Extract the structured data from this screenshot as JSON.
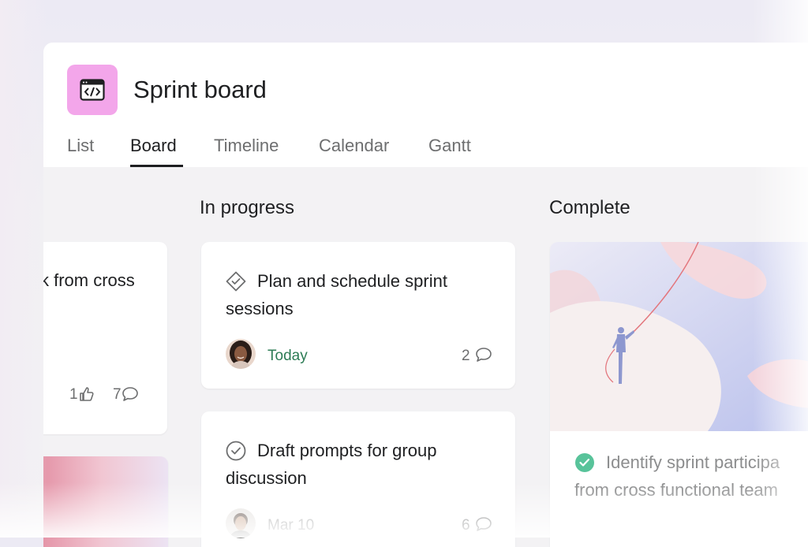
{
  "header": {
    "project_icon": "code-window-icon",
    "title": "Sprint board",
    "tabs": [
      {
        "label": "List"
      },
      {
        "label": "Board"
      },
      {
        "label": "Timeline"
      },
      {
        "label": "Calendar"
      },
      {
        "label": "Gantt"
      }
    ],
    "active_tab": "Board"
  },
  "columns": {
    "partial": {
      "card_text": "k from cross",
      "likes": "1",
      "comments": "7"
    },
    "in_progress": {
      "title": "In progress",
      "cards": [
        {
          "title_line1": "Plan and schedule sprint",
          "title_line2": "sessions",
          "due": "Today",
          "comments": "2"
        },
        {
          "title_line1": "Draft prompts for group",
          "title_line2": "discussion",
          "due": "Mar 10",
          "comments": "6"
        }
      ]
    },
    "complete": {
      "title": "Complete",
      "cards": [
        {
          "title_line1": "Identify sprint participa",
          "title_line2": "from cross functional team"
        }
      ]
    }
  },
  "colors": {
    "accent_icon_bg": "#f3a6ea",
    "due_green": "#2d7c55",
    "text_primary": "#1e1f21",
    "text_secondary": "#6d6e6f",
    "complete_check": "#58c39a"
  }
}
